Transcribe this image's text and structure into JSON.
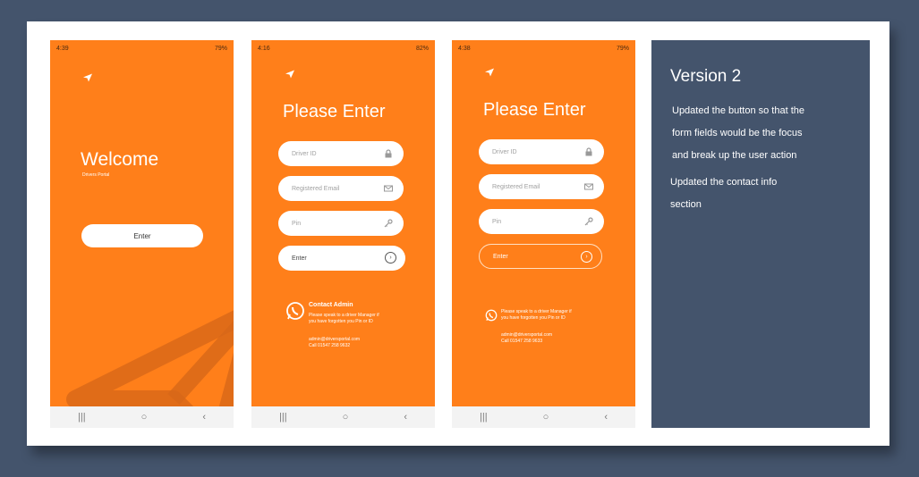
{
  "screens": [
    {
      "status_time": "4:39",
      "status_battery": "79%",
      "welcome_title": "Welcome",
      "welcome_subtitle": "Drivers Portal",
      "enter_button": "Enter"
    },
    {
      "status_time": "4:16",
      "status_battery": "82%",
      "title": "Please Enter",
      "driver_id_placeholder": "Driver ID",
      "email_placeholder": "Registered Email",
      "pin_placeholder": "Pin",
      "enter_label": "Enter",
      "contact_title": "Contact Admin",
      "contact_text_1": "Please speak to a driver Manager if",
      "contact_text_2": "you have forgotten you Pin or ID",
      "contact_email": "admin@driversportal.com",
      "contact_phone": "Call 01547 258 9632"
    },
    {
      "status_time": "4:38",
      "status_battery": "79%",
      "title": "Please Enter",
      "driver_id_placeholder": "Driver ID",
      "email_placeholder": "Registered Email",
      "pin_placeholder": "Pin",
      "enter_label": "Enter",
      "contact_text_1": "Please speak to a driver Manager if",
      "contact_text_2": "you have forgotten you Pin or ID",
      "contact_email": "admin@driversportal.com",
      "contact_phone": "Call 01547 258 9633"
    }
  ],
  "notes": {
    "title": "Version 2",
    "line1": "Updated the button so that the",
    "line2": "form fields would be the focus",
    "line3": "and break up the user action",
    "line4": "Updated the contact info",
    "line5": "section"
  },
  "colors": {
    "brand_orange": "#ff7f1a",
    "panel_slate": "#44546c"
  },
  "icons": [
    "paper-plane-icon",
    "lock-icon",
    "mail-icon",
    "key-icon",
    "arrow-circle-icon",
    "whatsapp-icon",
    "recent-apps-icon",
    "home-icon",
    "back-icon"
  ]
}
